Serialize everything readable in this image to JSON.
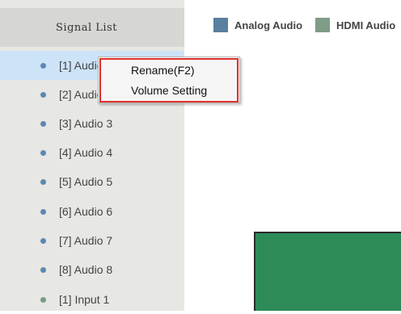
{
  "sidebar": {
    "title": "Signal List",
    "items": [
      {
        "label": "[1] Audio 1",
        "dot_color": "#5b88b4",
        "selected": true
      },
      {
        "label": "[2] Audio 2",
        "dot_color": "#5b88b4"
      },
      {
        "label": "[3] Audio 3",
        "dot_color": "#5b88b4"
      },
      {
        "label": "[4] Audio 4",
        "dot_color": "#5b88b4"
      },
      {
        "label": "[5] Audio 5",
        "dot_color": "#5b88b4"
      },
      {
        "label": "[6] Audio 6",
        "dot_color": "#5b88b4"
      },
      {
        "label": "[7] Audio 7",
        "dot_color": "#5b88b4"
      },
      {
        "label": "[8] Audio 8",
        "dot_color": "#5b88b4"
      },
      {
        "label": "[1] Input 1",
        "dot_color": "#7a9a86"
      }
    ]
  },
  "legend": [
    {
      "label": "Analog Audio",
      "color": "#5b7f9f"
    },
    {
      "label": "HDMI Audio",
      "color": "#7f9c87"
    }
  ],
  "context_menu": {
    "items": [
      {
        "label": "Rename(F2)"
      },
      {
        "label": "Volume Setting"
      }
    ]
  },
  "colors": {
    "selection": "#cde3f7",
    "highlight_outline": "#e0302b",
    "output_block": "#2e8b57"
  }
}
